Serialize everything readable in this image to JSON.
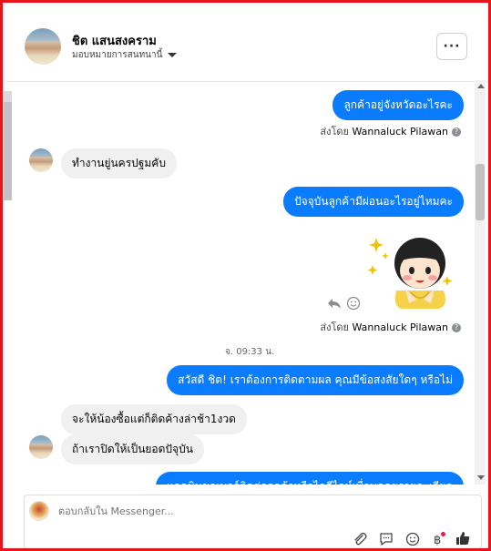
{
  "header": {
    "name": "ชิต แสนสงคราม",
    "assign_label": "มอบหมายการสนทนานี้",
    "more_label": "···"
  },
  "messages": {
    "m1": "ลูกค้าอยู่จังหวัดอะไรคะ",
    "sent_by_1_prefix": "ส่งโดย",
    "sent_by_1_name": "Wannaluck Pilawan",
    "m2": "ทำงานยู่นครปฐมคับ",
    "m3": "ปัจจุบันลูกค้ามีผ่อนอะไรอยู่ไหมคะ",
    "sent_by_2_prefix": "ส่งโดย",
    "sent_by_2_name": "Wannaluck Pilawan",
    "timestamp": "จ. 09:33 น.",
    "m4": "สวัสดี ชิต! เราต้องการติดตามผล คุณมีข้อสงสัยใดๆ หรือไม่",
    "m5": "จะให้น้องซื้อแต่ก็ติดค้างล่าช้า1งวด",
    "m6": "ถ้าเราปิดให้เป็นยอดปัจุบัน",
    "m7": "แอดมินขอเบอร์ติดต่อลูกค้าหรือไอดีไลน์เพื่อพูดคุยรายละเอียด"
  },
  "composer": {
    "placeholder": "ตอบกลับใน Messenger..."
  },
  "icons": {
    "attach": "paperclip-icon",
    "reply_preset": "speech-bubble-icon",
    "emoji": "smiley-icon",
    "baht": "baht-icon",
    "like": "thumbs-up-icon"
  },
  "colors": {
    "outgoing_bubble": "#0a7cff",
    "incoming_bubble": "#f0f0f0",
    "frame_border": "#e8141c"
  }
}
